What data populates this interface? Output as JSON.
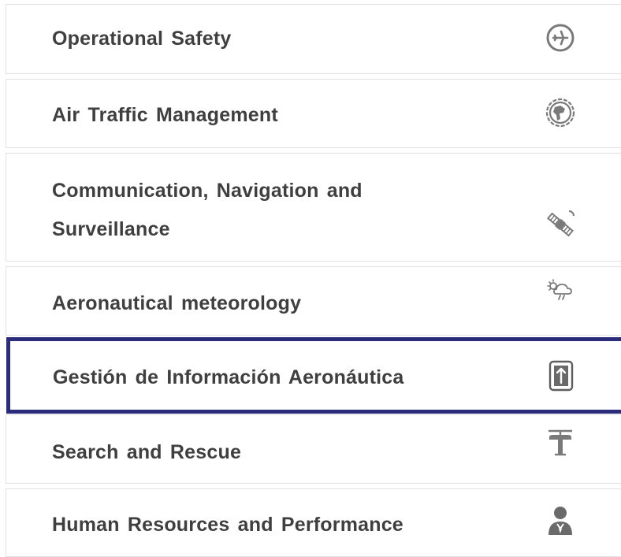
{
  "menu": {
    "items": [
      {
        "label": "Operational Safety",
        "icon": "airplane-circle-icon",
        "selected": false
      },
      {
        "label": "Air Traffic Management",
        "icon": "globe-icon",
        "selected": false
      },
      {
        "label_line1": "Communication, Navigation and",
        "label_line2": "Surveillance",
        "icon": "satellite-icon",
        "selected": false
      },
      {
        "label": "Aeronautical meteorology",
        "icon": "weather-cloud-icon",
        "selected": false
      },
      {
        "label": "Gestión de Información Aeronáutica",
        "icon": "document-upload-icon",
        "selected": true
      },
      {
        "label": "Search and Rescue",
        "icon": "helicopter-icon",
        "selected": false
      },
      {
        "label": "Human Resources and Performance",
        "icon": "person-icon",
        "selected": false
      }
    ]
  },
  "colors": {
    "text": "#3f3f3f",
    "icon": "#7a7a7a",
    "border": "#e2e2e2",
    "selected_border": "#2b2d7c"
  }
}
